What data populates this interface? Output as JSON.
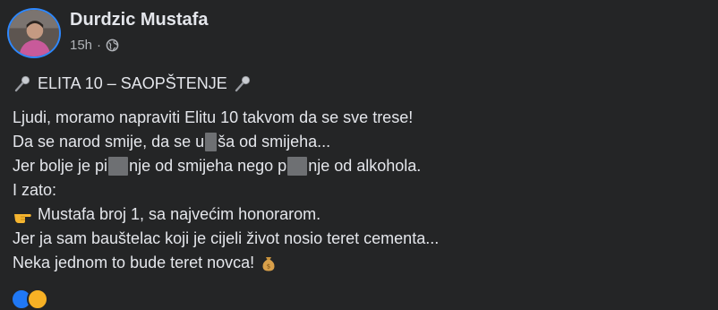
{
  "post": {
    "author": "Durdzic Mustafa",
    "time": "15h",
    "separator": "·",
    "audience_icon": "globe-icon",
    "title": "ELITA 10 – SAOPŠTENJE",
    "lines": {
      "l1": "Ljudi, moramo napraviti Elitu 10 takvom da se sve trese!",
      "l2_a": "Da se narod smije, da se u",
      "l2_b": "ša od smijeha...",
      "l3_a": "Jer bolje je pi",
      "l3_b": "nje od smijeha nego p",
      "l3_c": "nje od alkohola.",
      "l4": "I zato:",
      "l5": "Mustafa broj 1, sa najvećim honorarom.",
      "l6": "Jer ja sam bauštelac koji je cijeli život nosio teret cementa...",
      "l7": "Neka jednom to bude teret novca!"
    },
    "icons": [
      "microphone-icon",
      "pointing-hand-icon",
      "money-bag-icon"
    ]
  },
  "colors": {
    "background": "#242526",
    "text": "#e4e6eb",
    "secondary_text": "#b0b3b8",
    "avatar_ring": "#2d88ff"
  }
}
